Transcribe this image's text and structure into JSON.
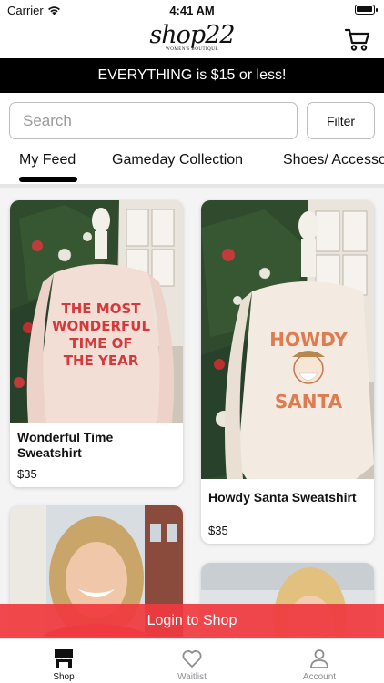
{
  "status_bar": {
    "carrier": "Carrier",
    "time": "4:41 AM",
    "battery_level": 1.0
  },
  "header": {
    "logo_text": "shop22",
    "logo_subtext": "WOMEN'S BOUTIQUE",
    "cart_icon": "cart-icon"
  },
  "promo": {
    "text": "EVERYTHING is $15 or less!"
  },
  "search": {
    "placeholder": "Search",
    "value": ""
  },
  "filter": {
    "label": "Filter"
  },
  "tabs": [
    {
      "label": "My Feed",
      "active": true
    },
    {
      "label": "Gameday Collection",
      "active": false
    },
    {
      "label": "Shoes/ Accessories",
      "active": false
    }
  ],
  "products": [
    {
      "title": "Wonderful Time Sweatshirt",
      "price": "$35",
      "print": [
        "THE MOST",
        "WONDERFUL",
        "TIME OF",
        "THE YEAR"
      ]
    },
    {
      "title": "Howdy Santa Sweatshirt",
      "price": "$35",
      "print": [
        "HOWDY",
        "SANTA"
      ]
    },
    {
      "title": "",
      "price": ""
    },
    {
      "title": "",
      "price": ""
    }
  ],
  "login_banner": {
    "text": "Login to Shop"
  },
  "tab_bar": [
    {
      "label": "Shop",
      "icon": "store-icon",
      "active": true
    },
    {
      "label": "Waitlist",
      "icon": "heart-icon",
      "active": false
    },
    {
      "label": "Account",
      "icon": "person-icon",
      "active": false
    }
  ],
  "colors": {
    "accent": "#f03a40",
    "promo_bg": "#000000",
    "inactive": "#8e8e93"
  }
}
